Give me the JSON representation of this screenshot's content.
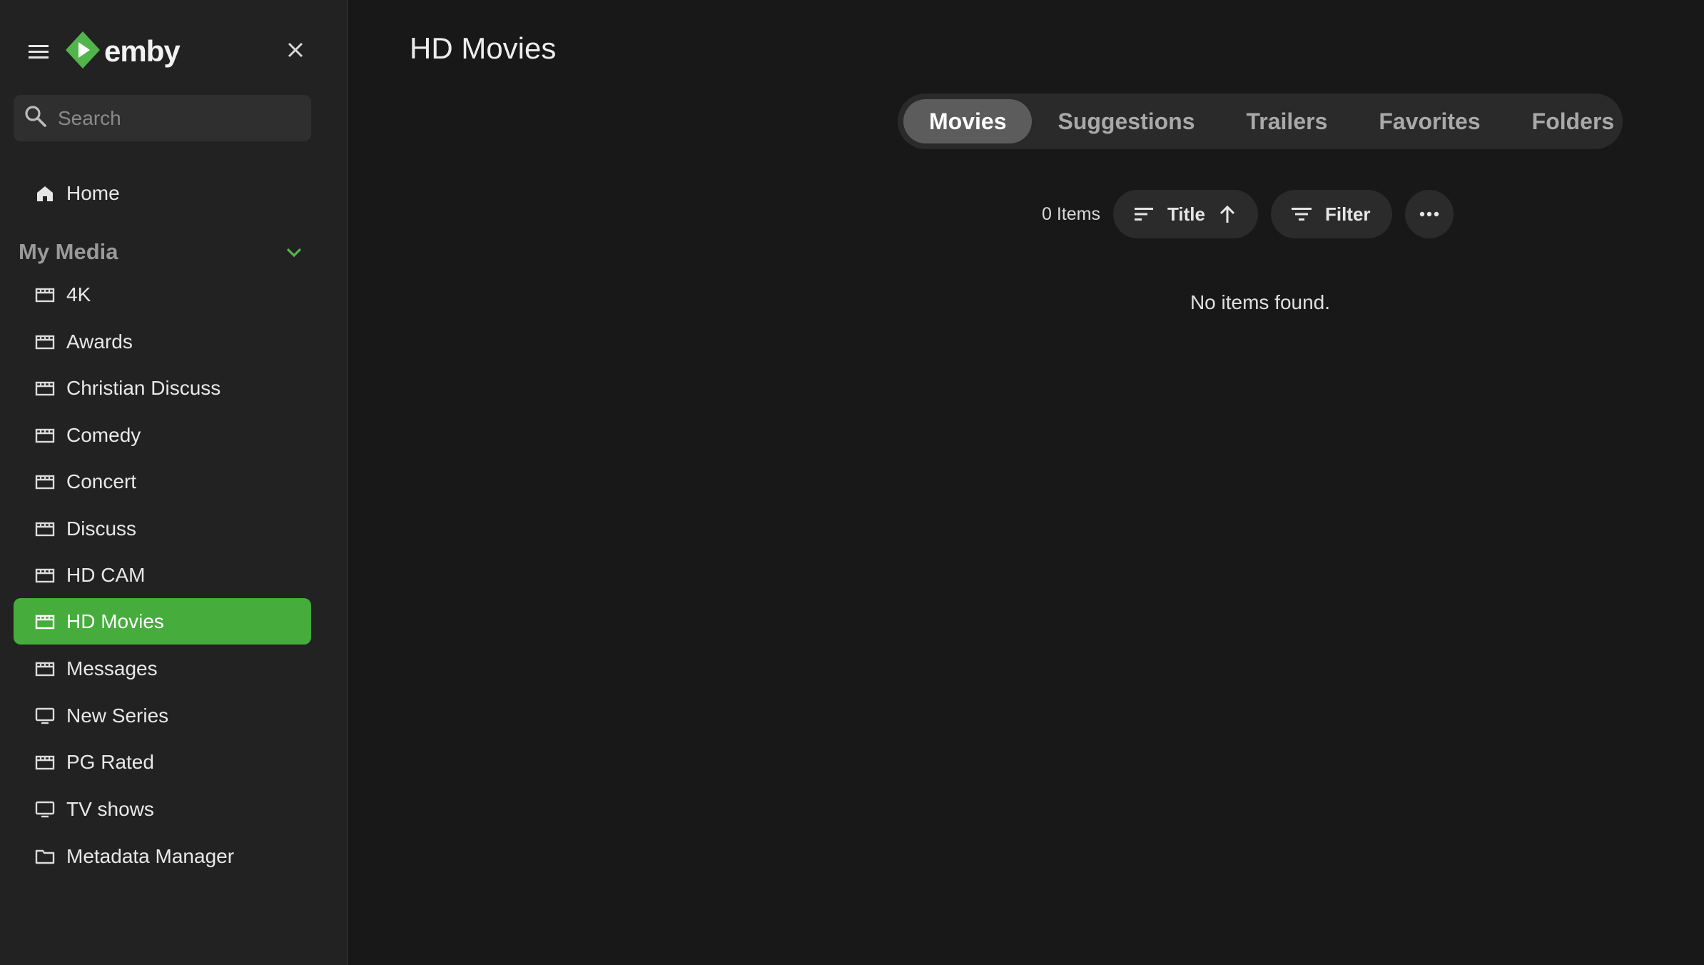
{
  "app": {
    "brand": "emby",
    "colors": {
      "accent": "#46ad3d",
      "background": "#181818",
      "sidebar": "#222222"
    }
  },
  "sidebar": {
    "menu_icon": "hamburger-menu-icon",
    "close_icon": "close-icon",
    "search": {
      "placeholder": "Search",
      "value": ""
    },
    "home": {
      "label": "Home",
      "icon": "home-icon"
    },
    "section": {
      "label": "My Media",
      "icon": "chevron-down-icon"
    },
    "items": [
      {
        "label": "4K",
        "icon": "movie-clapper-icon",
        "active": false
      },
      {
        "label": "Awards",
        "icon": "movie-clapper-icon",
        "active": false
      },
      {
        "label": "Christian Discuss",
        "icon": "movie-clapper-icon",
        "active": false
      },
      {
        "label": "Comedy",
        "icon": "movie-clapper-icon",
        "active": false
      },
      {
        "label": "Concert",
        "icon": "movie-clapper-icon",
        "active": false
      },
      {
        "label": "Discuss",
        "icon": "movie-clapper-icon",
        "active": false
      },
      {
        "label": "HD CAM",
        "icon": "movie-clapper-icon",
        "active": false
      },
      {
        "label": "HD Movies",
        "icon": "movie-clapper-icon",
        "active": true
      },
      {
        "label": "Messages",
        "icon": "movie-clapper-icon",
        "active": false
      },
      {
        "label": "New Series",
        "icon": "tv-icon",
        "active": false
      },
      {
        "label": "PG Rated",
        "icon": "movie-clapper-icon",
        "active": false
      },
      {
        "label": "TV shows",
        "icon": "tv-icon",
        "active": false
      },
      {
        "label": "Metadata Manager",
        "icon": "folder-icon",
        "active": false
      }
    ]
  },
  "main": {
    "title": "HD Movies",
    "tabs": [
      {
        "label": "Movies",
        "active": true
      },
      {
        "label": "Suggestions",
        "active": false
      },
      {
        "label": "Trailers",
        "active": false
      },
      {
        "label": "Favorites",
        "active": false
      },
      {
        "label": "Folders",
        "active": false
      }
    ],
    "toolbar": {
      "count": "0 Items",
      "sort_label": "Title",
      "sort_icon": "sort-lines-icon",
      "sort_direction_icon": "arrow-up-icon",
      "filter_label": "Filter",
      "filter_icon": "filter-icon",
      "more_icon": "more-horizontal-icon"
    },
    "empty_message": "No items found."
  }
}
